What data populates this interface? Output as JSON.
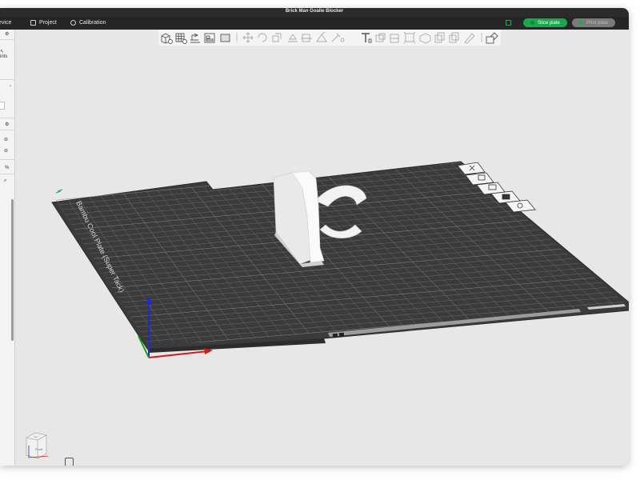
{
  "window": {
    "title": "Brick Man Goalie Blocker"
  },
  "menu": {
    "device_label": "evice",
    "project_label": "Project",
    "calibration_label": "Calibration",
    "slice_label": "Slice plate",
    "print_label": "Print plate"
  },
  "sidebar": {
    "ints_label": "ints",
    "percent_label": "%"
  },
  "plate": {
    "name_label": "Bambu Cool Plate (Super Tack)"
  },
  "view_cube": {
    "front_label": "Front",
    "top_label": "Top"
  },
  "colors": {
    "accent": "#1aa84e",
    "plate": "#3b3b3b",
    "grid": "#6a6a6a",
    "axis_x": "#d01b1b",
    "axis_y": "#1a9c1a",
    "axis_z": "#1a2ccf",
    "model": "#eeeeee"
  },
  "icons": [
    "cube-add-icon",
    "grid-icon",
    "auto-orient-icon",
    "arrange-icon",
    "plate-icon",
    "move-icon",
    "rotate-icon",
    "scale-icon",
    "flatten-icon",
    "cut-icon",
    "support-paint-icon",
    "seam-paint-icon",
    "text-icon",
    "mesh-boolean-icon",
    "measure-icon",
    "assembly-icon",
    "variable-layer-icon",
    "split-icon",
    "brim-ears-icon",
    "color-paint-icon"
  ]
}
